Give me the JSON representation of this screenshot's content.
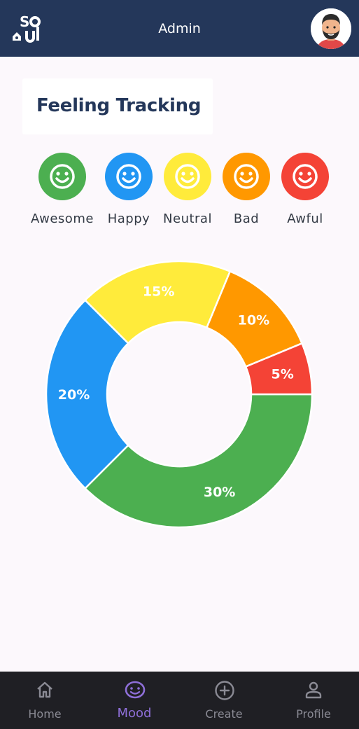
{
  "header": {
    "title": "Admin",
    "logo_text": "Soul"
  },
  "page": {
    "title": "Feeling Tracking"
  },
  "moods": [
    {
      "label": "Awesome",
      "color": "#4caf50"
    },
    {
      "label": "Happy",
      "color": "#2196f3"
    },
    {
      "label": "Neutral",
      "color": "#ffeb3b"
    },
    {
      "label": "Bad",
      "color": "#ff9800"
    },
    {
      "label": "Awful",
      "color": "#f44336"
    }
  ],
  "chart_data": {
    "type": "pie",
    "slices": [
      {
        "label": "30%",
        "value": 30,
        "color": "#4caf50"
      },
      {
        "label": "20%",
        "value": 20,
        "color": "#2196f3"
      },
      {
        "label": "15%",
        "value": 15,
        "color": "#ffeb3b"
      },
      {
        "label": "10%",
        "value": 10,
        "color": "#ff9800"
      },
      {
        "label": "5%",
        "value": 5,
        "color": "#f44336"
      }
    ]
  },
  "nav": {
    "items": [
      {
        "label": "Home",
        "icon": "home-icon"
      },
      {
        "label": "Mood",
        "icon": "mood-icon",
        "active": true
      },
      {
        "label": "Create",
        "icon": "add-circle-icon"
      },
      {
        "label": "Profile",
        "icon": "person-icon"
      }
    ]
  }
}
